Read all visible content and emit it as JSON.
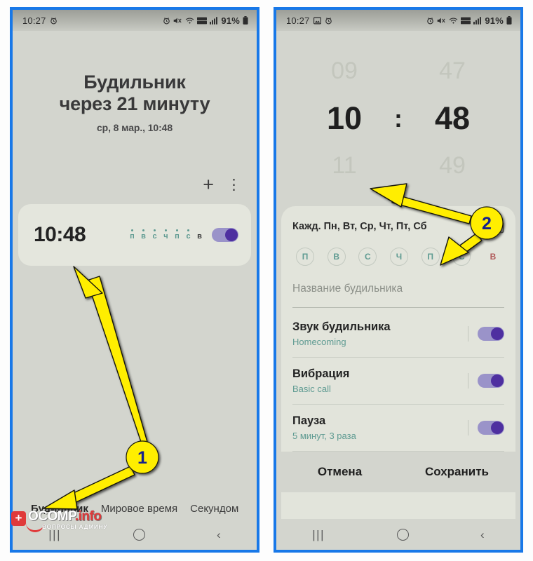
{
  "left_phone": {
    "statusbar": {
      "time": "10:27",
      "icons": [
        "alarm-icon",
        "mute-icon",
        "wifi-icon",
        "volte-icon",
        "signal-icon"
      ],
      "battery": "91%"
    },
    "header": {
      "title_line1": "Будильник",
      "title_line2": "через 21 минуту",
      "subtitle": "ср, 8 мар., 10:48"
    },
    "actions": {
      "add": "+",
      "more": "⋮"
    },
    "alarm_card": {
      "time": "10:48",
      "days": [
        {
          "letter": "п",
          "active": true
        },
        {
          "letter": "в",
          "active": true
        },
        {
          "letter": "с",
          "active": true
        },
        {
          "letter": "ч",
          "active": true
        },
        {
          "letter": "п",
          "active": true
        },
        {
          "letter": "с",
          "active": true
        },
        {
          "letter": "в",
          "active": false
        }
      ],
      "enabled": true
    },
    "tabs": [
      {
        "label": "Будильник",
        "active": true
      },
      {
        "label": "Мировое время",
        "active": false
      },
      {
        "label": "Секундом",
        "active": false
      }
    ],
    "navbar": {
      "recents": "|||",
      "home": "home-icon",
      "back": "‹"
    }
  },
  "right_phone": {
    "statusbar": {
      "time": "10:27",
      "icons": [
        "image-icon",
        "alarm-icon",
        "mute-icon",
        "wifi-icon",
        "volte-icon",
        "signal-icon"
      ],
      "battery": "91%"
    },
    "picker": {
      "hours": {
        "prev": "09",
        "selected": "10",
        "next": "11"
      },
      "separator": ":",
      "minutes": {
        "prev": "47",
        "selected": "48",
        "next": "49"
      }
    },
    "repeat": {
      "text": "Кажд. Пн, Вт, Ср, Чт, Пт, Сб",
      "calendar_icon": "calendar-icon",
      "day_circles": [
        {
          "letter": "П",
          "type": "weekday"
        },
        {
          "letter": "В",
          "type": "weekday"
        },
        {
          "letter": "С",
          "type": "weekday"
        },
        {
          "letter": "Ч",
          "type": "weekday"
        },
        {
          "letter": "П",
          "type": "weekday"
        },
        {
          "letter": "С",
          "type": "weekday"
        },
        {
          "letter": "В",
          "type": "sunday"
        }
      ]
    },
    "name_field": {
      "placeholder": "Название будильника",
      "value": ""
    },
    "settings": [
      {
        "title": "Звук будильника",
        "sub": "Homecoming",
        "enabled": true
      },
      {
        "title": "Вибрация",
        "sub": "Basic call",
        "enabled": true
      },
      {
        "title": "Пауза",
        "sub": "5 минут, 3 раза",
        "enabled": true
      }
    ],
    "buttons": {
      "cancel": "Отмена",
      "save": "Сохранить"
    },
    "navbar": {
      "recents": "|||",
      "home": "home-icon",
      "back": "‹"
    }
  },
  "annotations": {
    "markers": [
      {
        "id": "1",
        "label": "1"
      },
      {
        "id": "2",
        "label": "2"
      }
    ],
    "arrow_color": "#ffee00",
    "marker_text_color": "#18208c"
  },
  "watermark": {
    "main": "OCOMP",
    "suffix": ".info",
    "sub": "ВОПРОСЫ АДМИНУ",
    "plus": "+"
  },
  "theme": {
    "frame_border": "#1878e8",
    "screen_bg": "#d3d5ce",
    "card_bg": "#e4e6dd",
    "accent_teal": "#5f9b92",
    "toggle_track": "#9a93c9",
    "toggle_knob": "#4e2fa0",
    "sunday_red": "#b05a5a"
  }
}
